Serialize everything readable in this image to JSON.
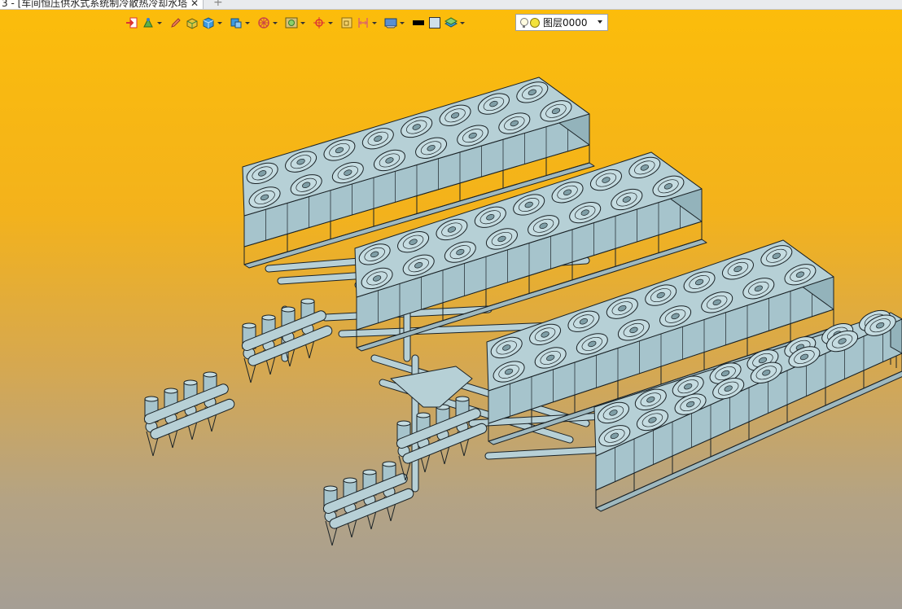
{
  "tab": {
    "title": "3 - [车间恒压供水式系统制冷散热冷却水塔]",
    "close_label": "✕",
    "add_label": "+"
  },
  "toolbar": {
    "icons": [
      "exit-icon",
      "snap-icon",
      "pencil-icon",
      "box-green-icon",
      "cube-blue-icon",
      "cube-blue2-icon",
      "wheel-icon",
      "image-icon",
      "crosshair-icon",
      "frame-icon",
      "measure-icon",
      "display-icon",
      "black-rect-icon",
      "gray-square-icon",
      "layers-icon"
    ]
  },
  "layer": {
    "name": "图层0000"
  },
  "colors": {
    "bg_top": "#fcbd0a",
    "bg_bottom": "#a59e94",
    "model_fill": "#a6c4cc",
    "model_line": "#1a2226"
  }
}
